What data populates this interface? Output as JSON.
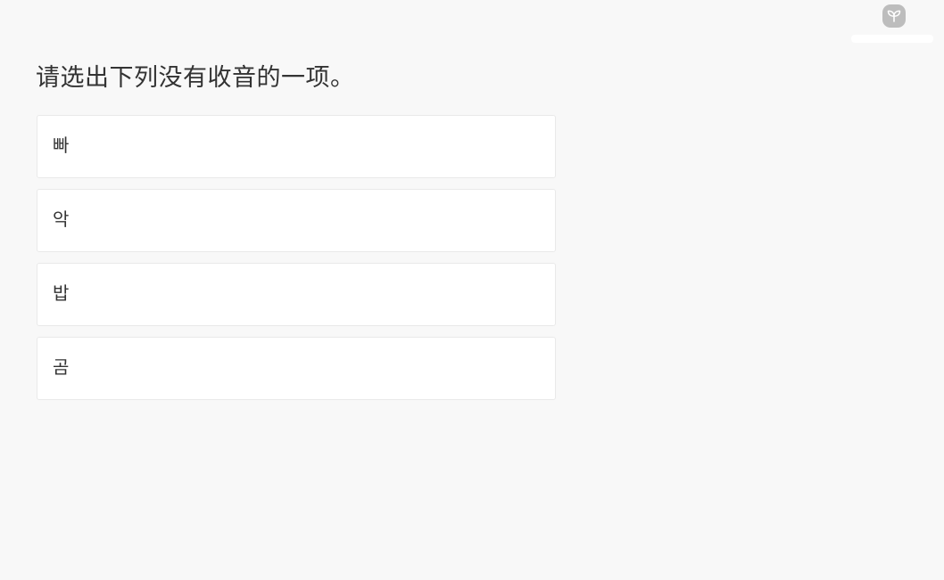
{
  "brand": {
    "logo_icon": "leaf-sprout-icon",
    "logo_color": "#bdbdbd"
  },
  "question": {
    "prompt": "请选出下列没有收音的一项。"
  },
  "options": [
    {
      "label": "빠"
    },
    {
      "label": "악"
    },
    {
      "label": "밥"
    },
    {
      "label": "곰"
    }
  ],
  "colors": {
    "background": "#f8f8f8",
    "card": "#ffffff",
    "card_border": "#e9e9e9",
    "text": "#333333"
  }
}
